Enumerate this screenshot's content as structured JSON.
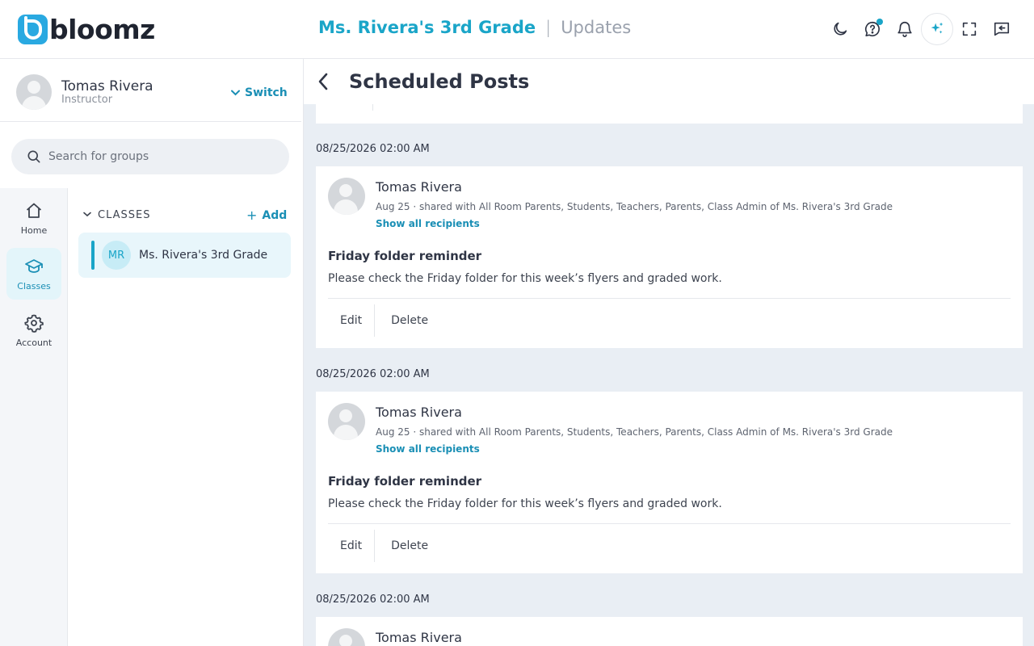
{
  "app": {
    "logo_text": "bloomz",
    "group_name": "Ms. Rivera's 3rd Grade",
    "separator": "|",
    "section": "Updates"
  },
  "user": {
    "name": "Tomas Rivera",
    "role": "Instructor",
    "switch_label": "Switch"
  },
  "search": {
    "placeholder": "Search for groups"
  },
  "rail": {
    "items": [
      {
        "label": "Home",
        "icon": "home-icon"
      },
      {
        "label": "Classes",
        "icon": "graduation-cap-icon"
      },
      {
        "label": "Account",
        "icon": "gear-icon"
      }
    ]
  },
  "classes": {
    "header": "CLASSES",
    "add_label": "Add",
    "items": [
      {
        "initials": "MR",
        "name": "Ms. Rivera's 3rd Grade"
      }
    ]
  },
  "main": {
    "title": "Scheduled Posts",
    "posts": [
      {
        "date": "08/25/2026 02:00 AM",
        "author": "Tomas Rivera",
        "meta": "Aug 25 · shared with All Room Parents, Students, Teachers, Parents, Class Admin of Ms. Rivera's 3rd Grade",
        "recipients_link": "Show all recipients",
        "title": "Friday folder reminder",
        "body": "Please check the Friday folder for this week’s flyers and graded work.",
        "edit": "Edit",
        "delete": "Delete"
      },
      {
        "date": "08/25/2026 02:00 AM",
        "author": "Tomas Rivera",
        "meta": "Aug 25 · shared with All Room Parents, Students, Teachers, Parents, Class Admin of Ms. Rivera's 3rd Grade",
        "recipients_link": "Show all recipients",
        "title": "Friday folder reminder",
        "body": "Please check the Friday folder for this week’s flyers and graded work.",
        "edit": "Edit",
        "delete": "Delete"
      },
      {
        "date": "08/25/2026 02:00 AM",
        "author": "Tomas Rivera"
      }
    ]
  },
  "colors": {
    "accent": "#1aa5c8",
    "link": "#1a8fb5",
    "main_bg": "#e9eef4"
  }
}
